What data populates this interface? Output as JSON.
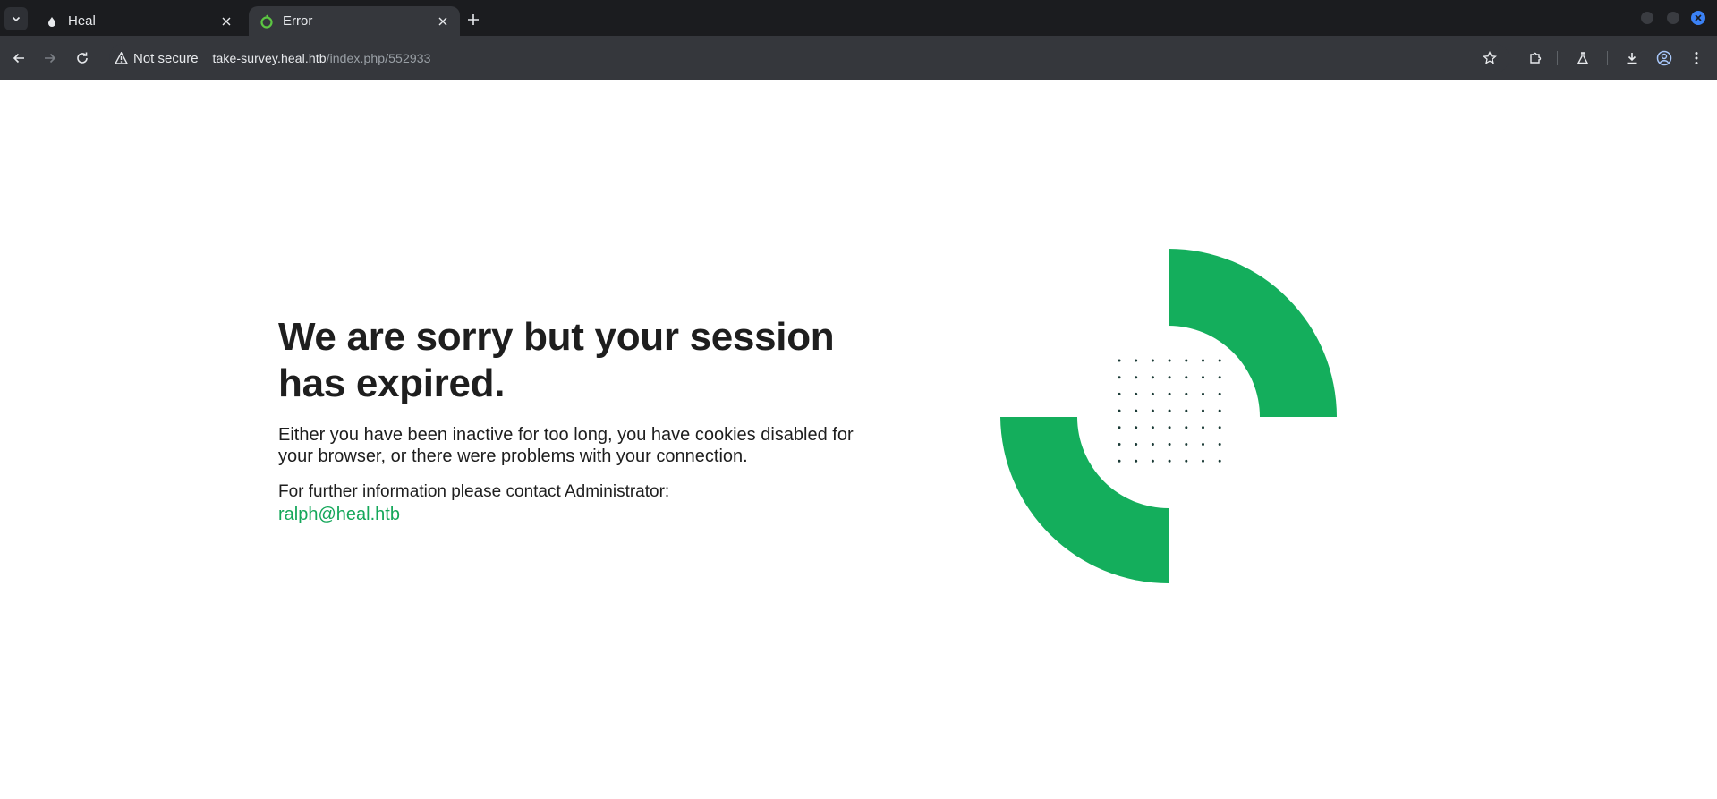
{
  "browser": {
    "tabs": [
      {
        "title": "Heal",
        "active": false
      },
      {
        "title": "Error",
        "active": true
      }
    ],
    "security_label": "Not secure",
    "url_host": "take-survey.heal.htb",
    "url_path": "/index.php/552933"
  },
  "page": {
    "heading": "We are sorry but your session has expired.",
    "description": "Either you have been inactive for too long, you have cookies disabled for your browser, or there were problems with your connection.",
    "contact_text": "For further information please contact Administrator:",
    "contact_email": "ralph@heal.htb"
  },
  "colors": {
    "accent_green": "#14a75a",
    "chrome_dark": "#1b1c1f",
    "toolbar": "#35373c",
    "text": "#1e1e1e"
  }
}
